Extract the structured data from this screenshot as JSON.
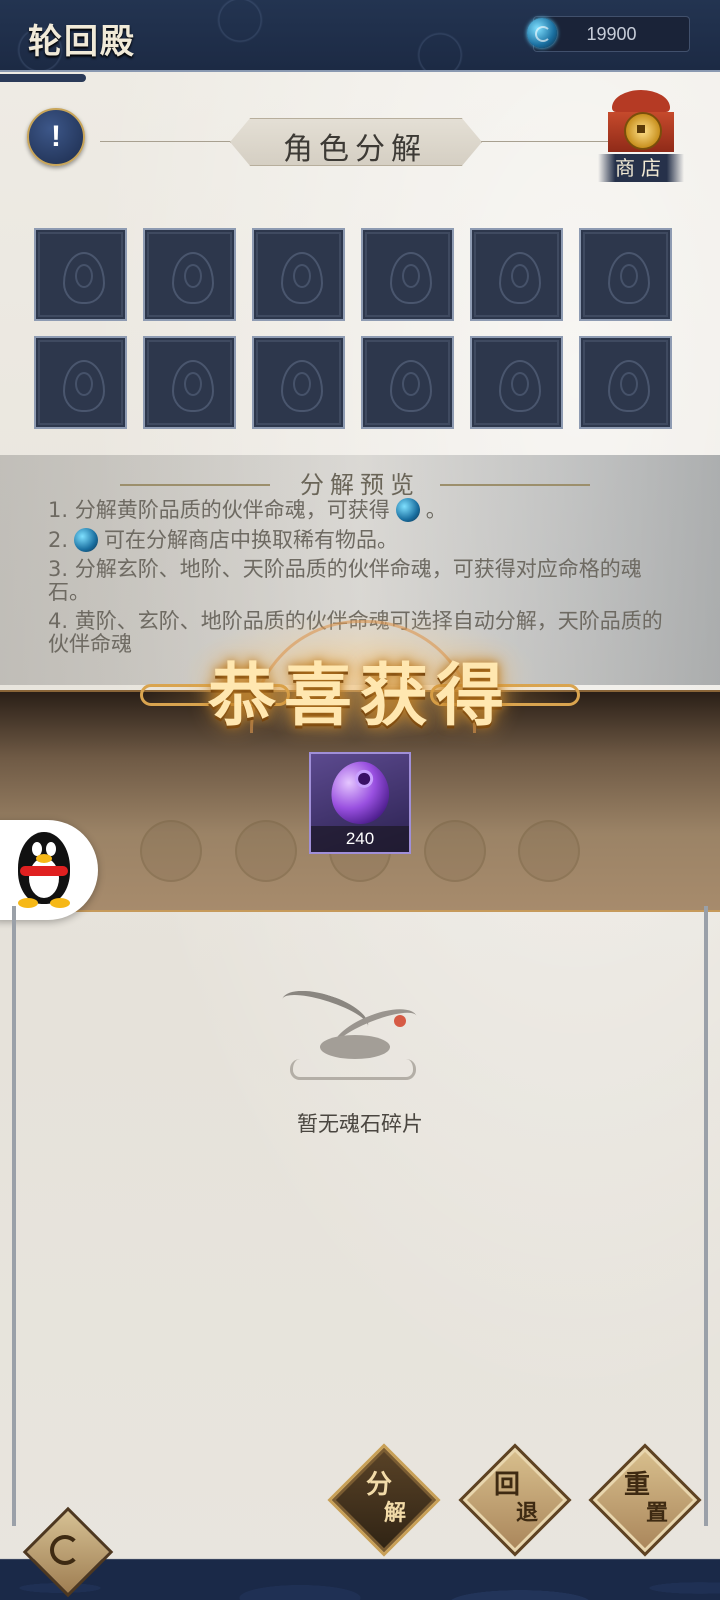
{
  "header": {
    "title": "轮回殿",
    "currency_value": "19900",
    "currency_icon": "soul-coin-icon"
  },
  "shop": {
    "label": "商店",
    "icon": "shop-pavilion-icon"
  },
  "section": {
    "title": "角色分解"
  },
  "slots": {
    "count": 12,
    "icon": "flame-soul-icon"
  },
  "preview": {
    "title": "分解预览",
    "rules": [
      {
        "prefix": "1. 分解黄阶品质的伙伴命魂，可获得",
        "suffix": "。"
      },
      {
        "prefix": "2.",
        "suffix": "可在分解商店中换取稀有物品。"
      },
      {
        "prefix": "3. 分解玄阶、地阶、天阶品质的伙伴命魂，可获得对应命格的魂石。",
        "suffix": ""
      },
      {
        "prefix": "4. 黄阶、玄阶、地阶品质的伙伴命魂可选择自动分解，天阶品质的伙伴命魂",
        "suffix": ""
      }
    ]
  },
  "reward": {
    "banner_title": "恭喜获得",
    "item_icon": "purple-soul-gem-icon",
    "item_count": "240"
  },
  "empty_state": {
    "text": "暂无魂石碎片",
    "icon": "crane-icon"
  },
  "actions": {
    "decompose": [
      "分",
      "解"
    ],
    "rollback": [
      "回",
      "退"
    ],
    "reset": [
      "重",
      "置"
    ]
  },
  "colors": {
    "header_bg": "#233451",
    "banner_title": "#ffe7b0",
    "slot_bg": "#2d374c",
    "reward_bg": "#5c4a8f"
  }
}
